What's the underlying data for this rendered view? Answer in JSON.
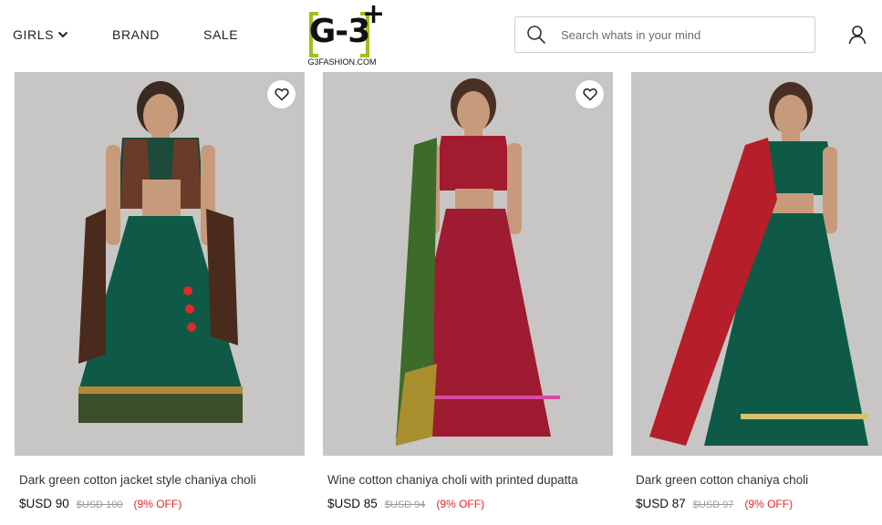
{
  "nav": {
    "items": [
      {
        "label": "GIRLS",
        "has_dropdown": true
      },
      {
        "label": "BRAND"
      },
      {
        "label": "SALE"
      }
    ]
  },
  "logo": {
    "main": "G-3",
    "plus": "+",
    "sub": "G3FASHION.COM",
    "accent": "#9bc31c"
  },
  "search": {
    "placeholder": "Search whats in your mind",
    "icon": "search-icon"
  },
  "header": {
    "user_icon": "user-icon"
  },
  "products": [
    {
      "title": "Dark green cotton jacket style chaniya choli",
      "price": "$USD 90",
      "mrp": "$USD 100",
      "discount": "(9% OFF)",
      "wishlist_visible": true,
      "skirt_color": "#0e5a46",
      "top_color": "#0f5a45"
    },
    {
      "title": "Wine cotton chaniya choli with printed dupatta",
      "price": "$USD 85",
      "mrp": "$USD 94",
      "discount": "(9% OFF)",
      "wishlist_visible": true,
      "skirt_color": "#9e1b32",
      "top_color": "#a31b2f"
    },
    {
      "title": "Dark green cotton chaniya choli",
      "price": "$USD 87",
      "mrp": "$USD 97",
      "discount": "(9% OFF)",
      "wishlist_visible": false,
      "skirt_color": "#0e5a46",
      "top_color": "#0f5a45"
    }
  ],
  "colors": {
    "discount": "#e0262e",
    "mrp": "#9a9a9a",
    "image_bg": "#c9c7c5"
  }
}
